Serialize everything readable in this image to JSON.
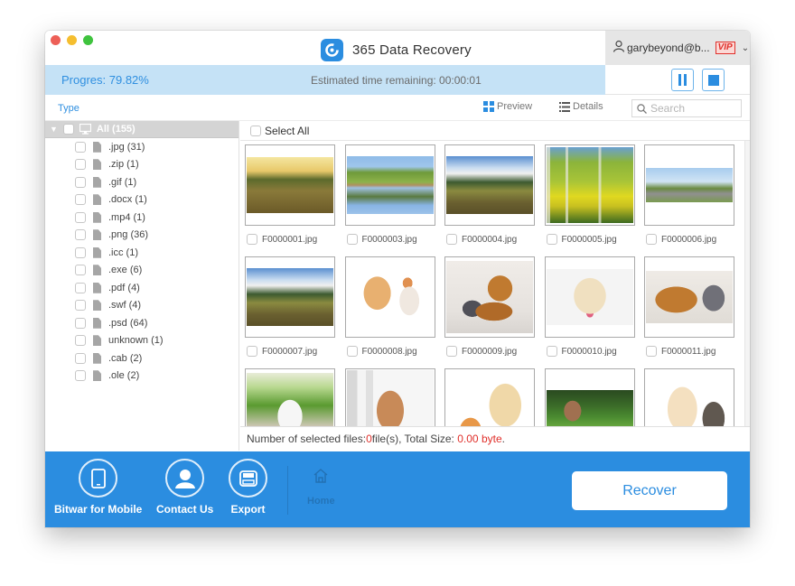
{
  "window": {
    "app_title": "365 Data Recovery",
    "account_name": "garybeyond@b...",
    "vip_badge": "VIP"
  },
  "progress": {
    "label": "Progres: 79.82%",
    "percent": 79.82,
    "eta_label": "Estimated time remaining: 00:00:01",
    "pause_icon": "pause-icon",
    "stop_icon": "stop-icon"
  },
  "toolbar": {
    "type_label": "Type",
    "preview_label": "Preview",
    "details_label": "Details",
    "search_placeholder": "Search",
    "search_value": ""
  },
  "tree": {
    "root_label": "All (155)",
    "items": [
      {
        "label": ".jpg (31)"
      },
      {
        "label": ".zip (1)"
      },
      {
        "label": ".gif (1)"
      },
      {
        "label": ".docx (1)"
      },
      {
        "label": ".mp4 (1)"
      },
      {
        "label": ".png (36)"
      },
      {
        "label": ".icc (1)"
      },
      {
        "label": ".exe (6)"
      },
      {
        "label": ".pdf (4)"
      },
      {
        "label": ".swf (4)"
      },
      {
        "label": ".psd (64)"
      },
      {
        "label": "unknown (1)"
      },
      {
        "label": ".cab (2)"
      },
      {
        "label": ".ole (2)"
      }
    ]
  },
  "grid": {
    "select_all_label": "Select All",
    "files": [
      {
        "name": "F0000001.jpg",
        "scene": "sunset field"
      },
      {
        "name": "F0000003.jpg",
        "scene": "lake reflection"
      },
      {
        "name": "F0000004.jpg",
        "scene": "meadow path"
      },
      {
        "name": "F0000005.jpg",
        "scene": "birch forest"
      },
      {
        "name": "F0000006.jpg",
        "scene": "country road"
      },
      {
        "name": "F0000007.jpg",
        "scene": "meadow path"
      },
      {
        "name": "F0000008.jpg",
        "scene": "pomeranian and cat"
      },
      {
        "name": "F0000009.jpg",
        "scene": "retriever and cat"
      },
      {
        "name": "F0000010.jpg",
        "scene": "golden retriever"
      },
      {
        "name": "F0000011.jpg",
        "scene": "dog and grey cat"
      },
      {
        "name": "",
        "scene": "puppy on grass"
      },
      {
        "name": "",
        "scene": "poodle puppy"
      },
      {
        "name": "",
        "scene": "kitten and puppy"
      },
      {
        "name": "",
        "scene": "french bulldog"
      },
      {
        "name": "",
        "scene": "puppy and kitten"
      }
    ]
  },
  "status": {
    "prefix": "Number of selected files: ",
    "count": "0",
    "middle": "file(s), Total Size: ",
    "size": "0.00 byte",
    "suffix": "."
  },
  "bottom": {
    "mobile_label": "Bitwar for Mobile",
    "contact_label": "Contact Us",
    "export_label": "Export",
    "home_label": "Home",
    "recover_label": "Recover"
  }
}
